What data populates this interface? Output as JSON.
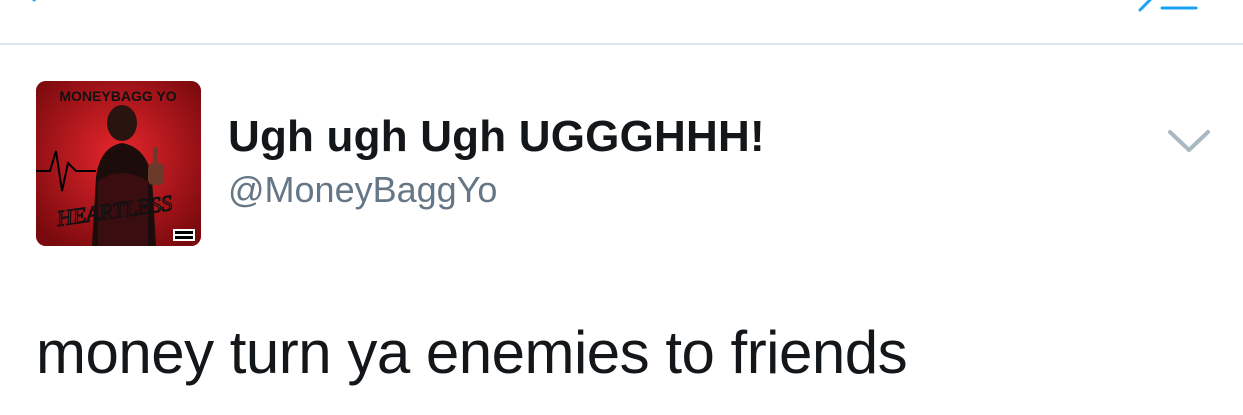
{
  "tweet": {
    "display_name": "Ugh ugh Ugh UGGGHHH!",
    "handle": "@MoneyBaggYo",
    "text": "money turn ya enemies to friends"
  },
  "avatar": {
    "artist_label": "MONEYBAGG YO",
    "album_label": "HEARTLESS"
  },
  "icons": {
    "back": "back-chevron-icon",
    "compose": "compose-icon",
    "caret": "chevron-down-icon"
  },
  "colors": {
    "text_primary": "#14171a",
    "text_secondary": "#657786",
    "divider": "#e1e8ed",
    "accent": "#1da1f2",
    "avatar_red": "#c4161c"
  }
}
